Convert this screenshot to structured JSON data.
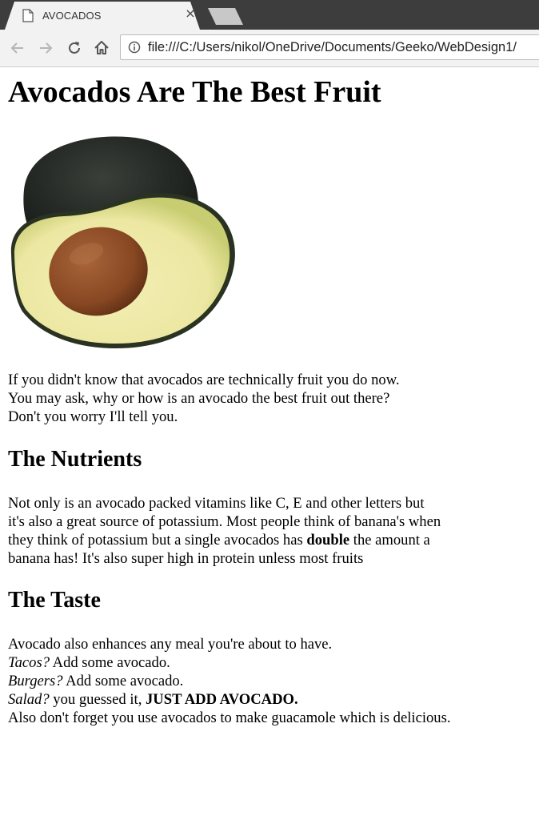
{
  "browser": {
    "tab_title": "AVOCADOS",
    "tab_close": "×",
    "url": "file:///C:/Users/nikol/OneDrive/Documents/Geeko/WebDesign1/"
  },
  "page": {
    "title": "Avocados Are The Best Fruit",
    "intro": [
      "If you didn't know that avocados are technically fruit you do now.",
      "You may ask, why or how is an avocado the best fruit out there?",
      "Don't you worry I'll tell you."
    ],
    "nutrients": {
      "heading": "The Nutrients",
      "line1": "Not only is an avocado packed vitamins like C, E and other letters but",
      "line2": "it's also a great source of potassium. Most people think of banana's when",
      "line3_before": "they think of potassium but a single avocados has ",
      "line3_bold": "double",
      "line3_after": " the amount a",
      "line4": "banana has! It's also super high in protein unless most fruits"
    },
    "taste": {
      "heading": "The Taste",
      "line1": "Avocado also enhances any meal you're about to have.",
      "tacos_q": "Tacos?",
      "tacos_rest": " Add some avocado.",
      "burgers_q": "Burgers?",
      "burgers_rest": " Add some avocado.",
      "salad_q": "Salad?",
      "salad_rest": " you guessed it, ",
      "salad_bold": "JUST ADD AVOCADO.",
      "line_last": "Also don't forget you use avocados to make guacamole which is delicious."
    }
  },
  "colors": {
    "tabstrip": "#3d3d3d",
    "toolbar": "#f2f2f2",
    "avocado_skin": "#1f2420",
    "avocado_flesh": "#eee9a8",
    "avocado_rim": "#8fa04a",
    "avocado_pit": "#8a4b26"
  },
  "icons": [
    "page-icon",
    "close-icon",
    "back-arrow-icon",
    "forward-arrow-icon",
    "reload-icon",
    "home-icon",
    "info-icon"
  ]
}
